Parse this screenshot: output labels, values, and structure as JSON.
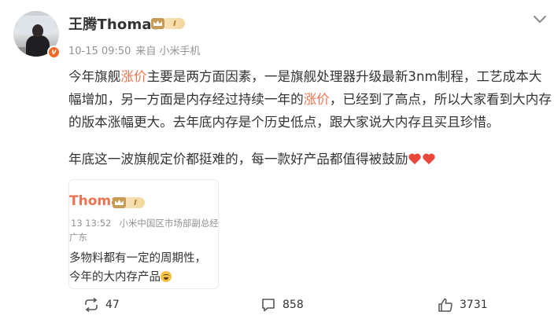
{
  "author": {
    "name": "王腾Thomas",
    "level_badge": "I",
    "verified_badge": "v"
  },
  "meta": {
    "timestamp": "10-15 09:50",
    "source": "来自 小米手机"
  },
  "post": {
    "seg1": "今年旗舰",
    "seg2": "涨价",
    "seg3": "主要是两方面因素，一是旗舰处理器升级最新3nm制程，工艺成本大幅增加，另一方面是内存经过持续一年的",
    "seg4": "涨价",
    "seg5": "，已经到了高点，所以大家看到大内存的版本涨幅更大。去年底内存是个历史低点，跟大家说大内存且买且珍惜。",
    "line2": "年底这一波旗舰定价都挺难的，每一款好产品都值得被鼓励"
  },
  "quote": {
    "name": "Thomas",
    "level_badge": "I",
    "date": "13 13:52",
    "title": "小米中国区市场部副总经",
    "location": "广东",
    "text_line1": "多物料都有一定的周期性，",
    "text_line2": "今年的大内存产品"
  },
  "actions": {
    "repost_count": "47",
    "comment_count": "858",
    "like_count": "3731"
  },
  "colors": {
    "highlight": "#eb7350",
    "text": "#333333",
    "meta": "#939393",
    "verified": "#f06a24",
    "crown": "#c89b55"
  },
  "icons": [
    "chevron-down-icon",
    "crown-icon",
    "verified-icon",
    "heart-icon",
    "repost-icon",
    "comment-icon",
    "like-icon",
    "grin-emoji-icon"
  ]
}
